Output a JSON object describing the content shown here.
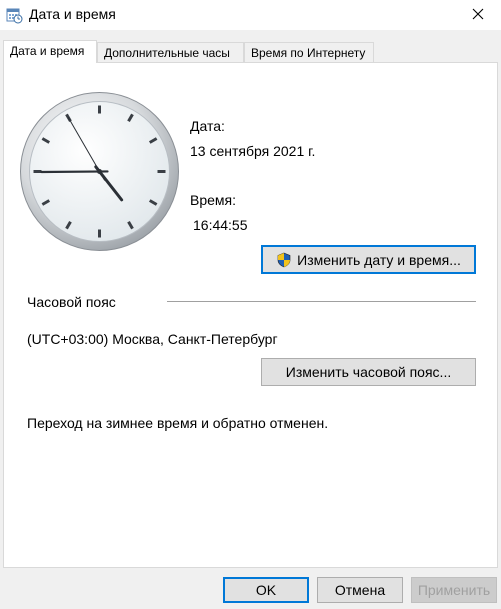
{
  "window": {
    "title": "Дата и время",
    "icon": "date-time-control-panel-icon",
    "close_icon": "close-icon"
  },
  "tabs": [
    {
      "label": "Дата и время",
      "active": true
    },
    {
      "label": "Дополнительные часы",
      "active": false
    },
    {
      "label": "Время по Интернету",
      "active": false
    }
  ],
  "clock": {
    "time": "16:44:55"
  },
  "date_section": {
    "date_label": "Дата:",
    "date_value": "13 сентября 2021 г.",
    "time_label": "Время:",
    "time_value": "16:44:55",
    "change_button": "Изменить дату и время...",
    "shield_icon": "uac-shield-icon"
  },
  "timezone": {
    "header": "Часовой пояс",
    "value": "(UTC+03:00) Москва, Санкт-Петербург",
    "change_button": "Изменить часовой пояс..."
  },
  "dst_note": "Переход на зимнее время и обратно отменен.",
  "footer": {
    "ok": "OK",
    "cancel": "Отмена",
    "apply": "Применить"
  }
}
